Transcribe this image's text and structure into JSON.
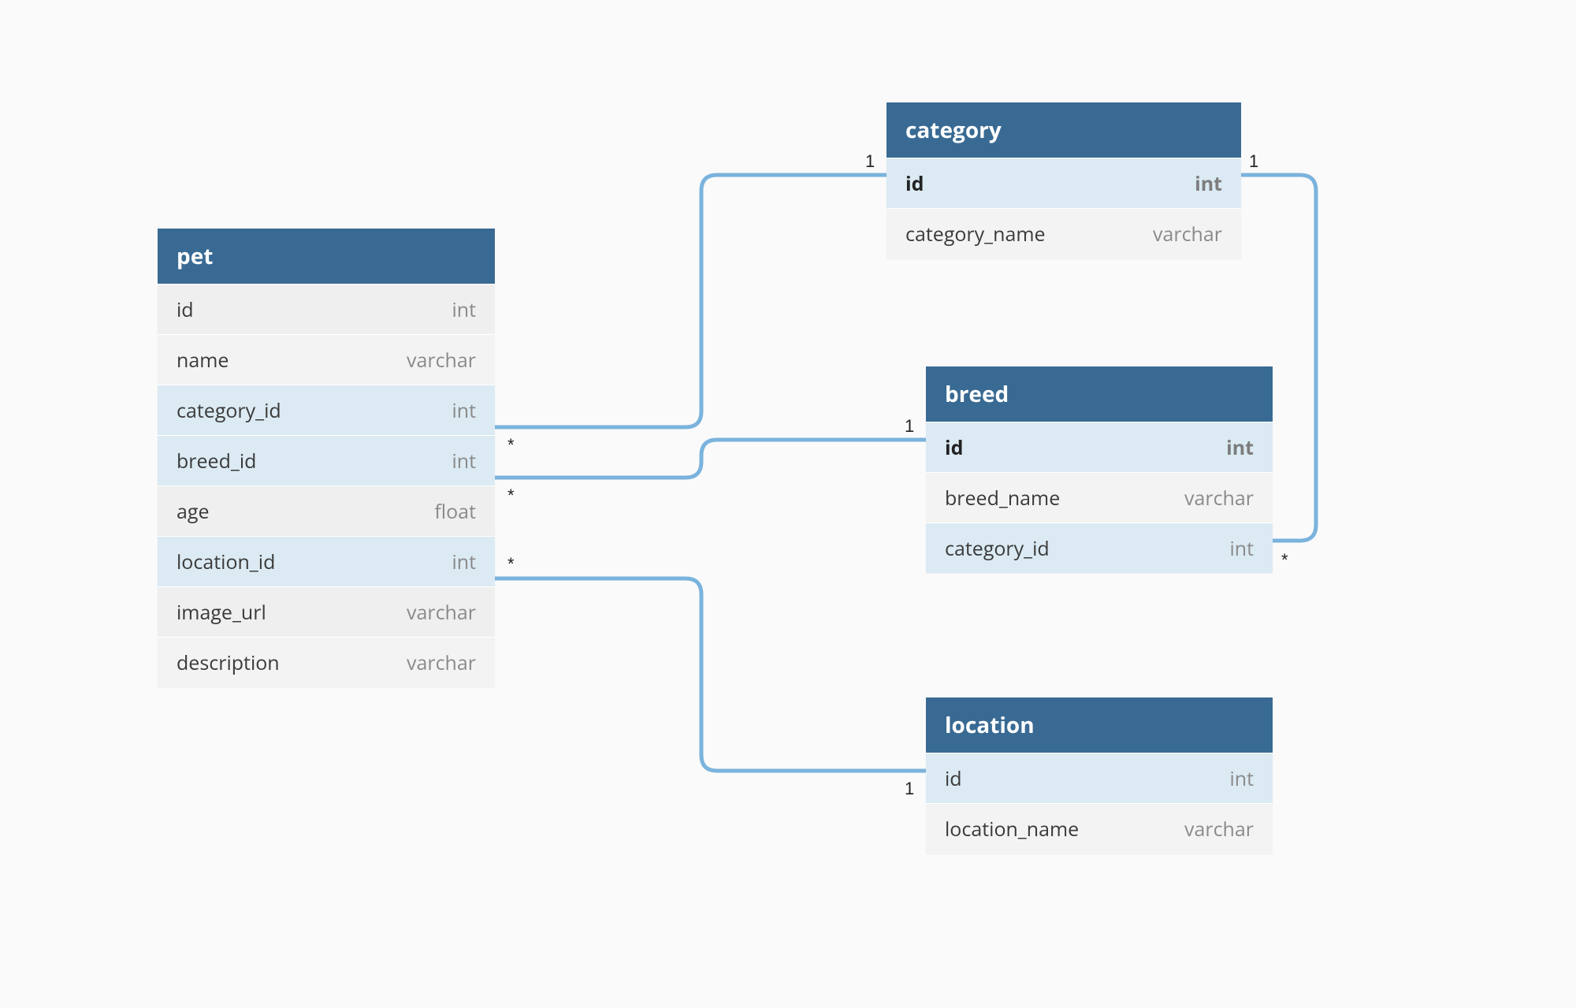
{
  "tables": {
    "pet": {
      "title": "pet",
      "columns": [
        {
          "name": "id",
          "type": "int",
          "style": "alt"
        },
        {
          "name": "name",
          "type": "varchar",
          "style": ""
        },
        {
          "name": "category_id",
          "type": "int",
          "style": "fk"
        },
        {
          "name": "breed_id",
          "type": "int",
          "style": "fk"
        },
        {
          "name": "age",
          "type": "float",
          "style": "alt"
        },
        {
          "name": "location_id",
          "type": "int",
          "style": "fk"
        },
        {
          "name": "image_url",
          "type": "varchar",
          "style": "alt"
        },
        {
          "name": "description",
          "type": "varchar",
          "style": ""
        }
      ]
    },
    "category": {
      "title": "category",
      "columns": [
        {
          "name": "id",
          "type": "int",
          "style": "fk pk"
        },
        {
          "name": "category_name",
          "type": "varchar",
          "style": ""
        }
      ]
    },
    "breed": {
      "title": "breed",
      "columns": [
        {
          "name": "id",
          "type": "int",
          "style": "fk pk"
        },
        {
          "name": "breed_name",
          "type": "varchar",
          "style": ""
        },
        {
          "name": "category_id",
          "type": "int",
          "style": "fk"
        }
      ]
    },
    "location": {
      "title": "location",
      "columns": [
        {
          "name": "id",
          "type": "int",
          "style": "fk"
        },
        {
          "name": "location_name",
          "type": "varchar",
          "style": ""
        }
      ]
    }
  },
  "cardinalities": {
    "pet_cat_many": "*",
    "pet_breed_many": "*",
    "pet_loc_many": "*",
    "cat_one_left": "1",
    "cat_one_right": "1",
    "breed_one": "1",
    "breed_cat_many": "*",
    "loc_one": "1"
  },
  "relationships": [
    {
      "from": "pet.category_id",
      "to": "category.id",
      "type": "many-to-one"
    },
    {
      "from": "pet.breed_id",
      "to": "breed.id",
      "type": "many-to-one"
    },
    {
      "from": "pet.location_id",
      "to": "location.id",
      "type": "many-to-one"
    },
    {
      "from": "breed.category_id",
      "to": "category.id",
      "type": "many-to-one"
    }
  ]
}
